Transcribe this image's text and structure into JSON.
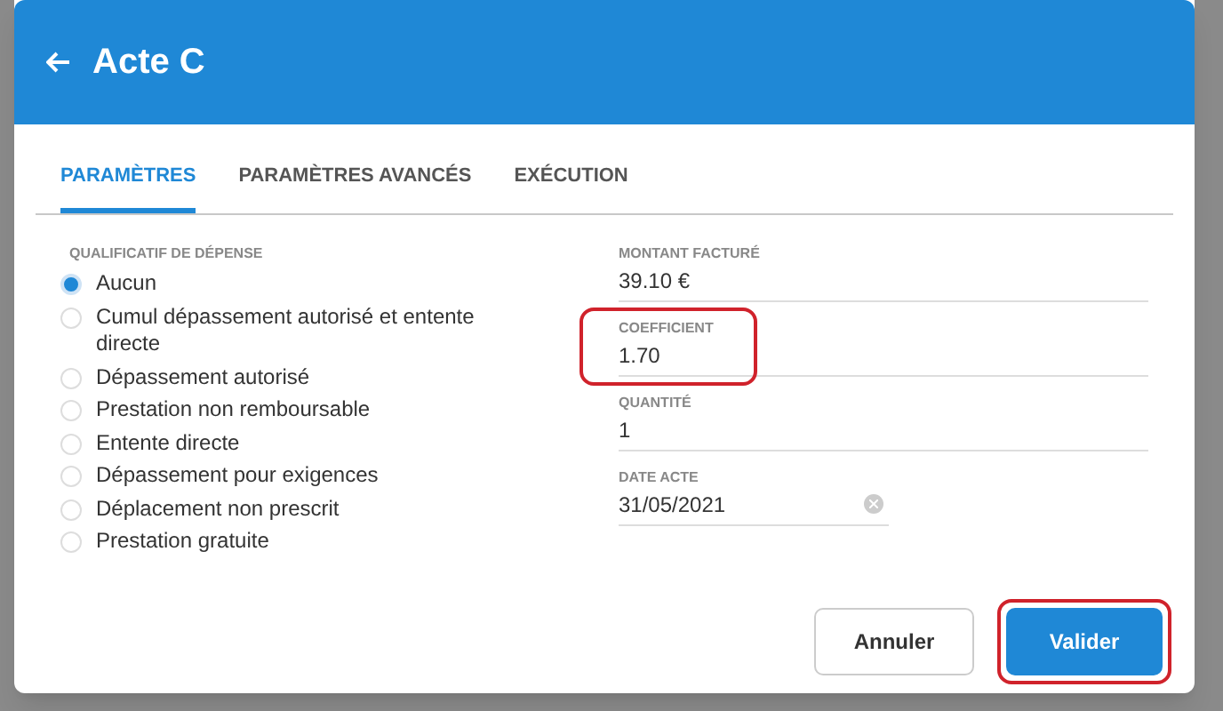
{
  "dialog": {
    "title": "Acte C"
  },
  "tabs": [
    {
      "label": "PARAMÈTRES",
      "selected": true
    },
    {
      "label": "PARAMÈTRES AVANCÉS",
      "selected": false
    },
    {
      "label": "EXÉCUTION",
      "selected": false
    }
  ],
  "expense_qualifier": {
    "label": "QUALIFICATIF DE DÉPENSE",
    "options": [
      {
        "label": "Aucun",
        "selected": true
      },
      {
        "label": "Cumul dépassement autorisé et entente directe",
        "selected": false
      },
      {
        "label": "Dépassement autorisé",
        "selected": false
      },
      {
        "label": "Prestation non remboursable",
        "selected": false
      },
      {
        "label": "Entente directe",
        "selected": false
      },
      {
        "label": "Dépassement pour exigences",
        "selected": false
      },
      {
        "label": "Déplacement non prescrit",
        "selected": false
      },
      {
        "label": "Prestation gratuite",
        "selected": false
      }
    ]
  },
  "fields": [
    {
      "kind": "text",
      "label": "MONTANT FACTURÉ",
      "value": "39.10 €",
      "highlighted": false
    },
    {
      "kind": "text",
      "label": "COEFFICIENT",
      "value": "1.70",
      "highlighted": true
    },
    {
      "kind": "text",
      "label": "QUANTITÉ",
      "value": "1",
      "highlighted": false
    },
    {
      "kind": "date",
      "label": "DATE ACTE",
      "value": "31/05/2021",
      "highlighted": false
    }
  ],
  "buttons": [
    {
      "kind": "secondary",
      "label": "Annuler",
      "highlighted": false
    },
    {
      "kind": "primary",
      "label": "Valider",
      "highlighted": true
    }
  ]
}
